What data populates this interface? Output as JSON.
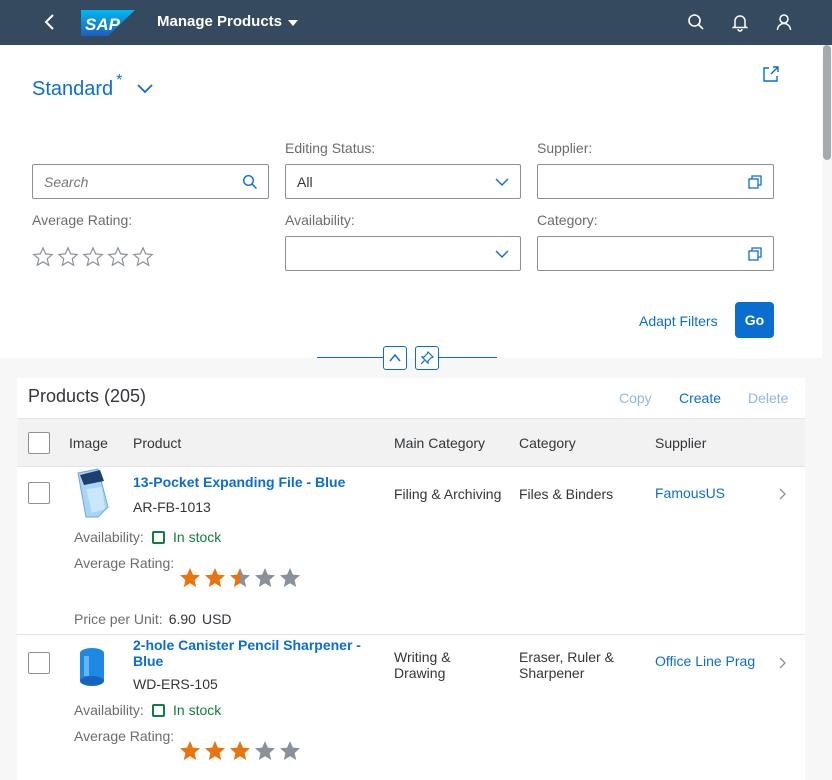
{
  "shell": {
    "logo_text": "SAP",
    "app_title": "Manage Products",
    "icons": [
      "back-icon",
      "search-icon",
      "bell-icon",
      "user-icon"
    ]
  },
  "variant": {
    "name": "Standard",
    "modified_marker": "*"
  },
  "filters": {
    "search": {
      "placeholder": "Search"
    },
    "editing_status": {
      "label": "Editing Status:",
      "value": "All"
    },
    "supplier": {
      "label": "Supplier:",
      "value": ""
    },
    "average_rating": {
      "label": "Average Rating:",
      "stars": 5
    },
    "availability": {
      "label": "Availability:",
      "value": ""
    },
    "category": {
      "label": "Category:",
      "value": ""
    },
    "adapt_filters_label": "Adapt Filters",
    "go_label": "Go"
  },
  "table": {
    "title": "Products (205)",
    "actions": {
      "copy": "Copy",
      "create": "Create",
      "delete": "Delete"
    },
    "columns": [
      "Image",
      "Product",
      "Main Category",
      "Category",
      "Supplier"
    ],
    "rows": [
      {
        "name": "13-Pocket Expanding File - Blue",
        "id": "AR-FB-1013",
        "main_category": "Filing & Archiving",
        "category": "Files & Binders",
        "supplier": "FamousUS",
        "availability_label": "Availability:",
        "availability": "In stock",
        "rating_label": "Average Rating:",
        "rating": 2.5,
        "price_label": "Price per Unit:",
        "price": "6.90",
        "currency": "USD"
      },
      {
        "name": "2-hole Canister Pencil Sharpener - Blue",
        "id": "WD-ERS-105",
        "main_category": "Writing & Drawing",
        "category": "Eraser, Ruler & Sharpener",
        "supplier": "Office Line Prag",
        "availability_label": "Availability:",
        "availability": "In stock",
        "rating_label": "Average Rating:",
        "rating": 3
      }
    ]
  },
  "colors": {
    "shell": "#354a5f",
    "accent": "#0a6ed1",
    "rating": "#e9730c",
    "rating_empty": "#89919a",
    "success": "#107e3e"
  }
}
